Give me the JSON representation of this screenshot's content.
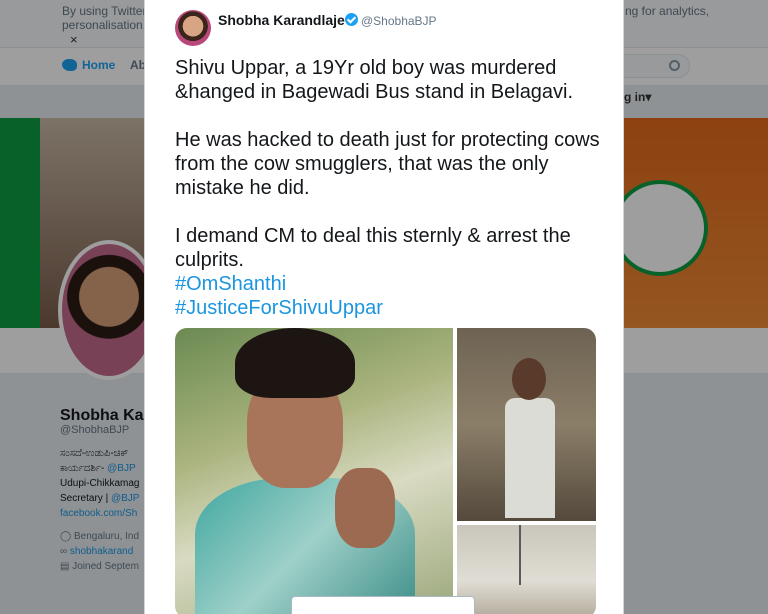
{
  "background": {
    "cookie_notice": {
      "line1": "By using Twitter's",
      "line2": "personalisation, a",
      "line1_right": "ng for analytics,",
      "dismiss": "×"
    },
    "nav": {
      "home_label": "Home",
      "about_label": "Abo",
      "login_label": "g in▾"
    },
    "profile": {
      "name": "Shobha Ka",
      "handle": "@ShobhaBJP",
      "bio_line1": "ಸಂಸದೆ-ಉಡುಪಿ-ಚಿಕ್",
      "bio_line2_prefix": "ಕಾರ್ಯದರ್ಶಿ- ",
      "bio_line2_link": "@BJP",
      "bio_line3": "Udupi-Chikkamag",
      "bio_line4_prefix": "Secretary | ",
      "bio_line4_link": "@BJP",
      "bio_line5_link": "facebook.com/Sh",
      "location": "Bengaluru, Ind",
      "website": "shobhakarand",
      "joined": "Joined Septem"
    }
  },
  "tweet": {
    "author_name": "Shobha Karandlaje",
    "author_handle": "@ShobhaBJP",
    "paragraph1": "Shivu Uppar, a 19Yr old boy was murdered &hanged in Bagewadi Bus stand in Belagavi.",
    "paragraph2": "He was hacked to death just for protecting cows from the cow smugglers, that was the only mistake he did.",
    "paragraph3": "I demand CM to deal this sternly & arrest the culprits.",
    "hashtag1": "#OmShanthi",
    "hashtag2": "#JusticeForShivuUppar"
  },
  "colors": {
    "link": "#1b95e0",
    "verified": "#1da1f2",
    "banner_green": "#0f9d45",
    "banner_orange": "#e46a1c"
  },
  "icons": {
    "verified": "verified-badge-icon",
    "twitter": "twitter-bird-icon",
    "search": "search-icon",
    "location": "location-pin-icon",
    "link": "link-icon",
    "calendar": "calendar-icon"
  }
}
